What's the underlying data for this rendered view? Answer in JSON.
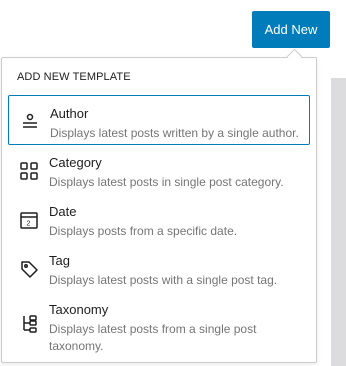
{
  "header": {
    "add_new_label": "Add New"
  },
  "popover": {
    "heading": "ADD NEW TEMPLATE",
    "items": [
      {
        "title": "Author",
        "description": "Displays latest posts written by a single author.",
        "icon": "author-icon",
        "selected": true
      },
      {
        "title": "Category",
        "description": "Displays latest posts in single post category.",
        "icon": "category-icon",
        "selected": false
      },
      {
        "title": "Date",
        "description": "Displays posts from a specific date.",
        "icon": "date-icon",
        "selected": false
      },
      {
        "title": "Tag",
        "description": "Displays latest posts with a single post tag.",
        "icon": "tag-icon",
        "selected": false
      },
      {
        "title": "Taxonomy",
        "description": "Displays latest posts from a single post taxonomy.",
        "icon": "taxonomy-icon",
        "selected": false
      }
    ]
  },
  "colors": {
    "accent": "#007cba",
    "text": "#1e1e1e",
    "muted": "#757575",
    "border": "#cccccc"
  }
}
